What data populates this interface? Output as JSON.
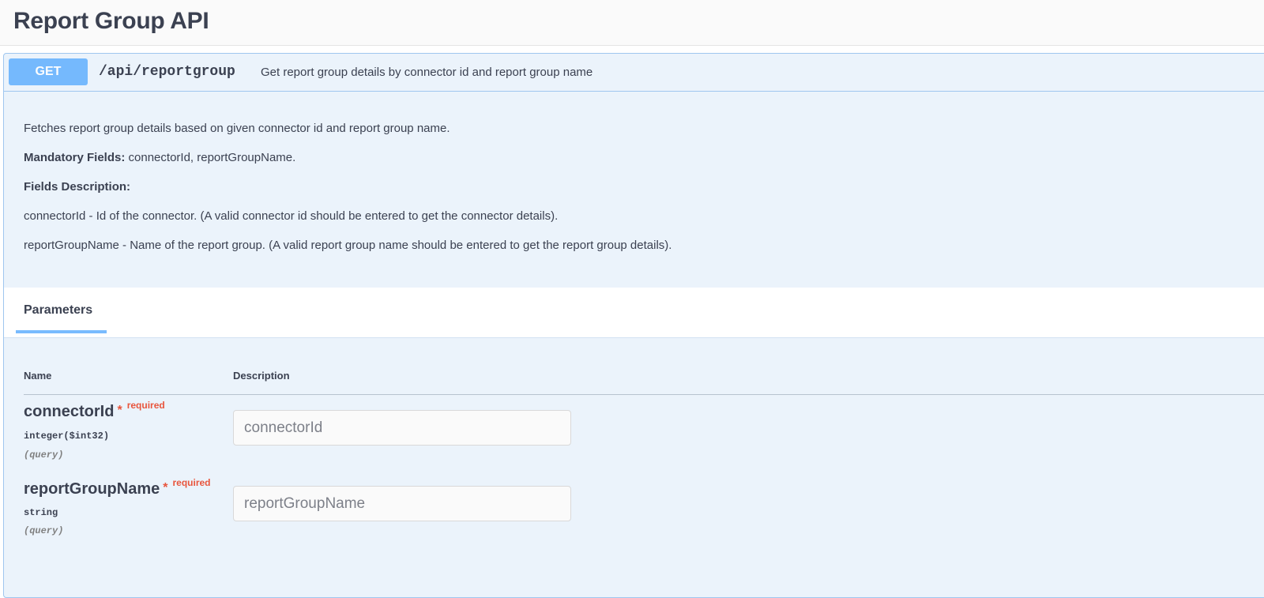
{
  "page": {
    "title": "Report Group API"
  },
  "operation": {
    "method": "GET",
    "path": "/api/reportgroup",
    "summary": "Get report group details by connector id and report group name",
    "description": {
      "intro": "Fetches report group details based on given connector id and report group name.",
      "mandatory_label": "Mandatory Fields:",
      "mandatory_value": " connectorId, reportGroupName.",
      "fields_label": "Fields Description:",
      "field_1": "connectorId - Id of the connector. (A valid connector id should be entered to get the connector details).",
      "field_2": "reportGroupName - Name of the report group. (A valid report group name should be entered to get the report group details)."
    },
    "colors": {
      "method_accent": "#61affe",
      "block_background": "#ebf3fb",
      "required": "#e8553d"
    }
  },
  "parameters": {
    "tab_label": "Parameters",
    "col_name": "Name",
    "col_description": "Description",
    "items": [
      {
        "name": "connectorId",
        "required_star": "*",
        "required_text": "required",
        "type": "integer($int32)",
        "in": "(query)",
        "placeholder": "connectorId",
        "value": ""
      },
      {
        "name": "reportGroupName",
        "required_star": "*",
        "required_text": "required",
        "type": "string",
        "in": "(query)",
        "placeholder": "reportGroupName",
        "value": ""
      }
    ]
  }
}
